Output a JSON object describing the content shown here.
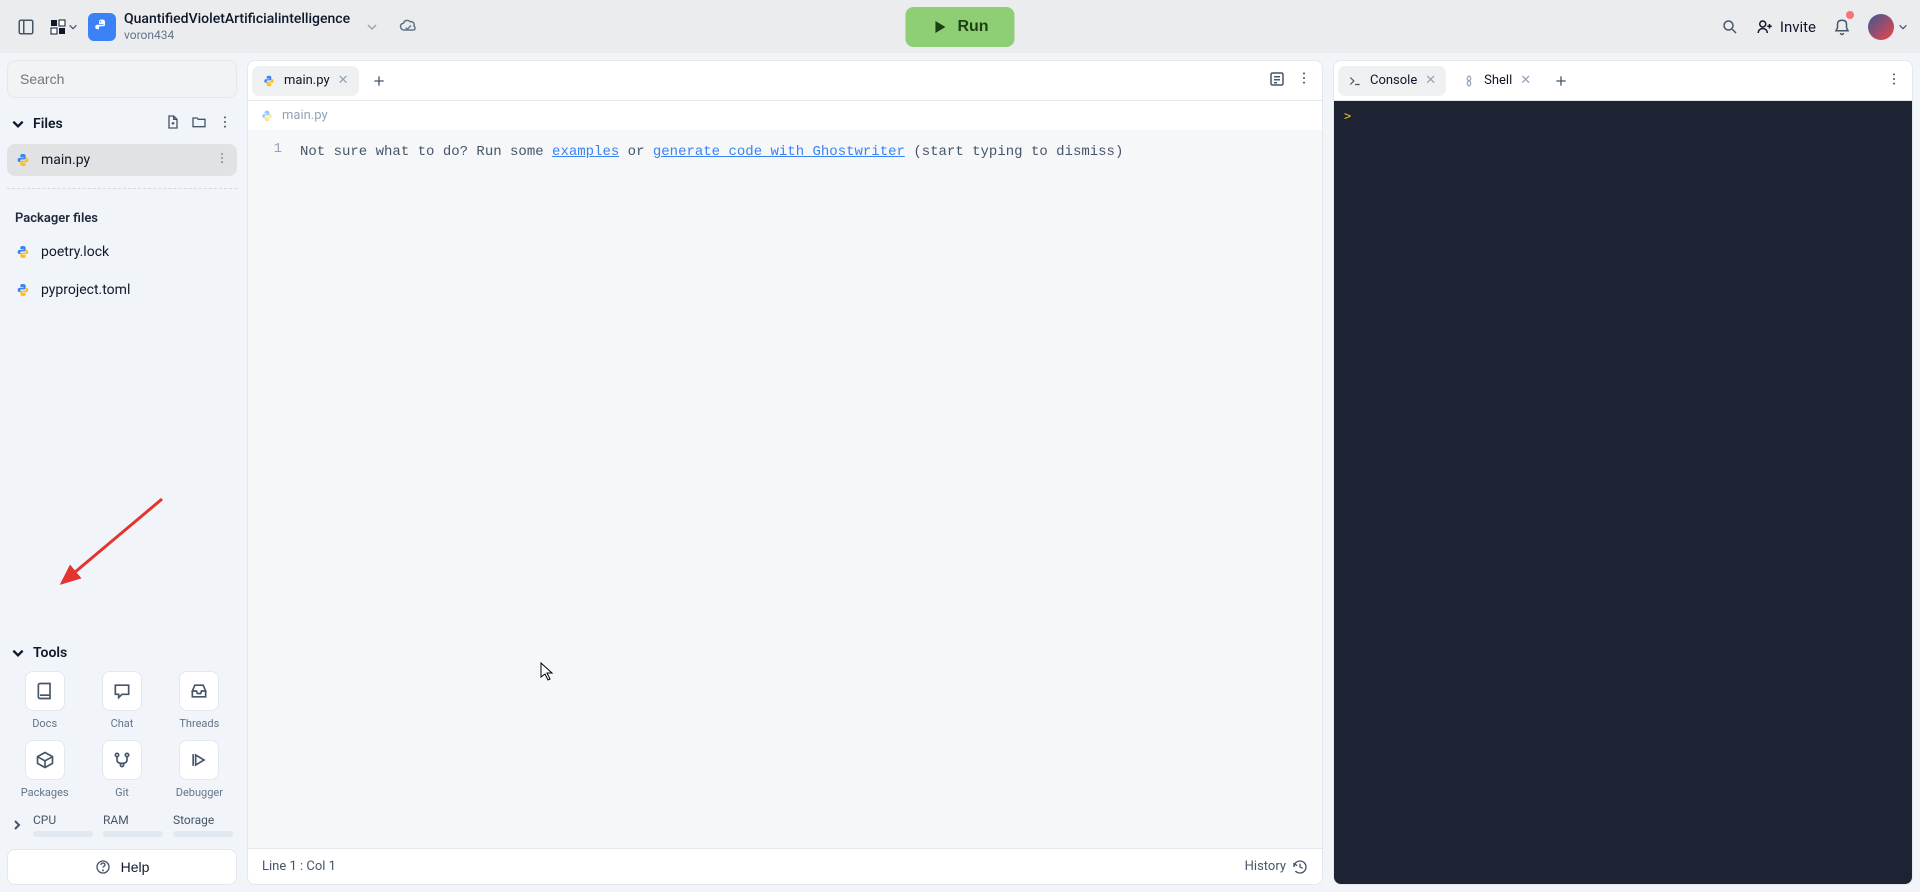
{
  "header": {
    "project_title": "QuantifiedVioletArtificialintelligence",
    "project_user": "voron434",
    "run_label": "Run",
    "invite_label": "Invite"
  },
  "sidebar": {
    "search_placeholder": "Search",
    "files_header": "Files",
    "files": [
      {
        "name": "main.py",
        "active": true
      }
    ],
    "packager_header": "Packager files",
    "packager_files": [
      {
        "name": "poetry.lock"
      },
      {
        "name": "pyproject.toml"
      }
    ],
    "tools_header": "Tools",
    "tools": [
      {
        "label": "Docs"
      },
      {
        "label": "Chat"
      },
      {
        "label": "Threads"
      },
      {
        "label": "Packages"
      },
      {
        "label": "Git"
      },
      {
        "label": "Debugger"
      }
    ],
    "metrics": [
      {
        "label": "CPU"
      },
      {
        "label": "RAM"
      },
      {
        "label": "Storage"
      }
    ],
    "help_label": "Help"
  },
  "editor": {
    "tab_label": "main.py",
    "breadcrumb": "main.py",
    "line_number": "1",
    "hint_pre": "Not sure what to do? Run some ",
    "hint_link1": "examples",
    "hint_mid": " or ",
    "hint_link2": "generate code with Ghostwriter",
    "hint_post": " (start typing to dismiss)",
    "status_left": "Line 1 : Col 1",
    "history_label": "History"
  },
  "right": {
    "tab_console": "Console",
    "tab_shell": "Shell",
    "prompt": ">"
  },
  "colors": {
    "run_bg": "#8ecf76",
    "accent_link": "#3b82f6",
    "console_bg": "#1d2333"
  }
}
